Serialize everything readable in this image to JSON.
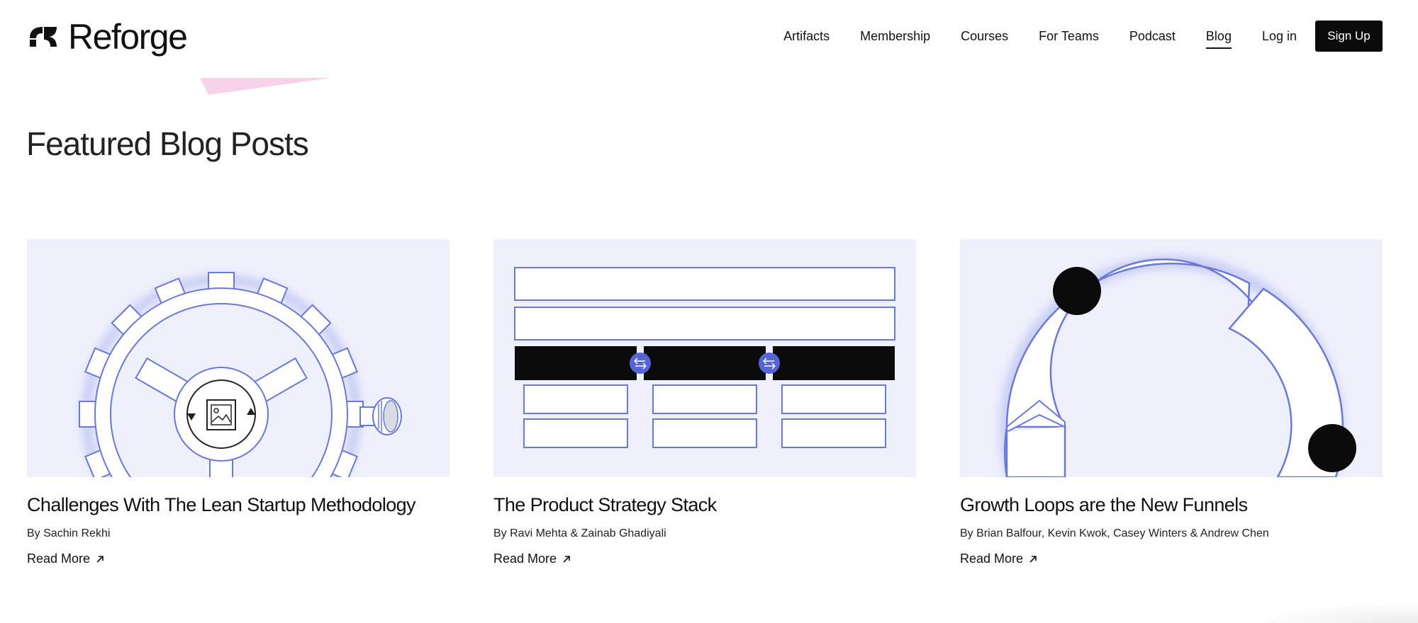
{
  "header": {
    "brand": "Reforge",
    "nav": [
      {
        "label": "Artifacts",
        "active": false
      },
      {
        "label": "Membership",
        "active": false
      },
      {
        "label": "Courses",
        "active": false
      },
      {
        "label": "For Teams",
        "active": false
      },
      {
        "label": "Podcast",
        "active": false
      },
      {
        "label": "Blog",
        "active": true
      },
      {
        "label": "Log in",
        "active": false
      }
    ],
    "signup_label": "Sign Up"
  },
  "section": {
    "title": "Featured Blog Posts"
  },
  "posts": [
    {
      "title": "Challenges With The Lean Startup Methodology",
      "author": "By Sachin Rekhi",
      "read_more": "Read More",
      "illustration": "gear-illustration"
    },
    {
      "title": "The Product Strategy Stack",
      "author": "By Ravi Mehta & Zainab Ghadiyali",
      "read_more": "Read More",
      "illustration": "strategy-stack-illustration"
    },
    {
      "title": "Growth Loops are the New Funnels",
      "author": "By Brian Balfour, Kevin Kwok, Casey Winters & Andrew Chen",
      "read_more": "Read More",
      "illustration": "growth-loop-illustration"
    }
  ],
  "colors": {
    "thumb_bg": "#eef0fc",
    "accent": "#6a78d8",
    "ink": "#0b0b0b",
    "pink": "#f6d3ea"
  }
}
